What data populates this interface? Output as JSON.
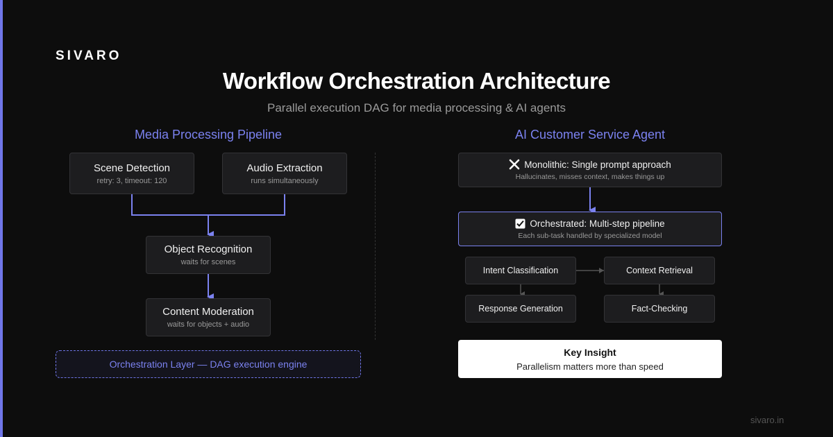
{
  "brand": "SIVARO",
  "title": "Workflow Orchestration Architecture",
  "subtitle": "Parallel execution DAG for media processing & AI agents",
  "left": {
    "heading": "Media Processing Pipeline",
    "nodes": [
      {
        "label": "Scene Detection",
        "sub": "retry: 3, timeout: 120"
      },
      {
        "label": "Audio Extraction",
        "sub": "runs simultaneously"
      },
      {
        "label": "Object Recognition",
        "sub": "waits for scenes"
      },
      {
        "label": "Content Moderation",
        "sub": "waits for objects + audio"
      }
    ],
    "orchestration_layer": "Orchestration Layer — DAG execution engine"
  },
  "right": {
    "heading": "AI Customer Service Agent",
    "monolithic": {
      "label": "Monolithic: Single prompt approach",
      "sub": "Hallucinates, misses context, makes things up",
      "icon": "cross-icon"
    },
    "orchestrated": {
      "label": "Orchestrated: Multi-step pipeline",
      "sub": "Each sub-task handled by specialized model",
      "icon": "checkbox-icon"
    },
    "steps": [
      "Intent Classification",
      "Context Retrieval",
      "Response Generation",
      "Fact-Checking"
    ],
    "insight": {
      "title": "Key Insight",
      "text": "Parallelism matters more than speed"
    }
  },
  "footer": "sivaro.in",
  "colors": {
    "accent": "#6f76e8",
    "background": "#0d0d0d",
    "node": "#1d1d1f"
  }
}
